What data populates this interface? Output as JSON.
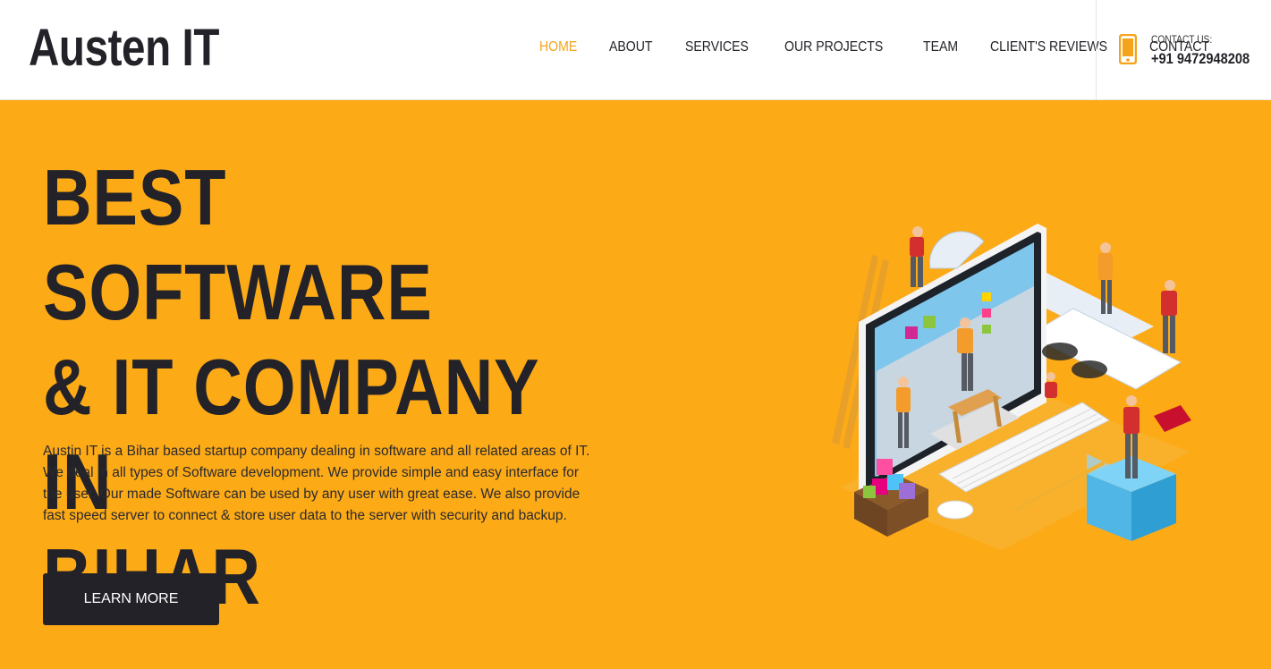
{
  "header": {
    "logo": "Austen IT",
    "nav": [
      {
        "label": "HOME",
        "active": true
      },
      {
        "label": "ABOUT",
        "active": false
      },
      {
        "label": "SERVICES",
        "active": false
      },
      {
        "label": "OUR PROJECTS",
        "active": false
      },
      {
        "label": "TEAM",
        "active": false
      },
      {
        "label": "CLIENT'S REVIEWS",
        "active": false
      },
      {
        "label": "CONTACT",
        "active": false
      }
    ],
    "contact_label": "CONTACT US:",
    "contact_phone": "+91 9472948208",
    "phone_icon": "mobile-phone-icon"
  },
  "hero": {
    "title_lines": [
      "BEST SOFTWARE",
      "& IT COMPANY IN",
      "BIHAR"
    ],
    "description": "Austin IT is a Bihar based startup company dealing in software and all related areas of IT. We deal in all types of Software development. We provide simple and easy interface for the user. Our made Software can be used by any user with great ease. We also provide fast speed server to connect & store user data to the server with security and backup.",
    "button_label": "LEARN MORE",
    "illustration": "isometric-software-team-illustration"
  },
  "colors": {
    "accent": "#fdaa17",
    "nav_active": "#f5a31a",
    "dark": "#222228"
  }
}
